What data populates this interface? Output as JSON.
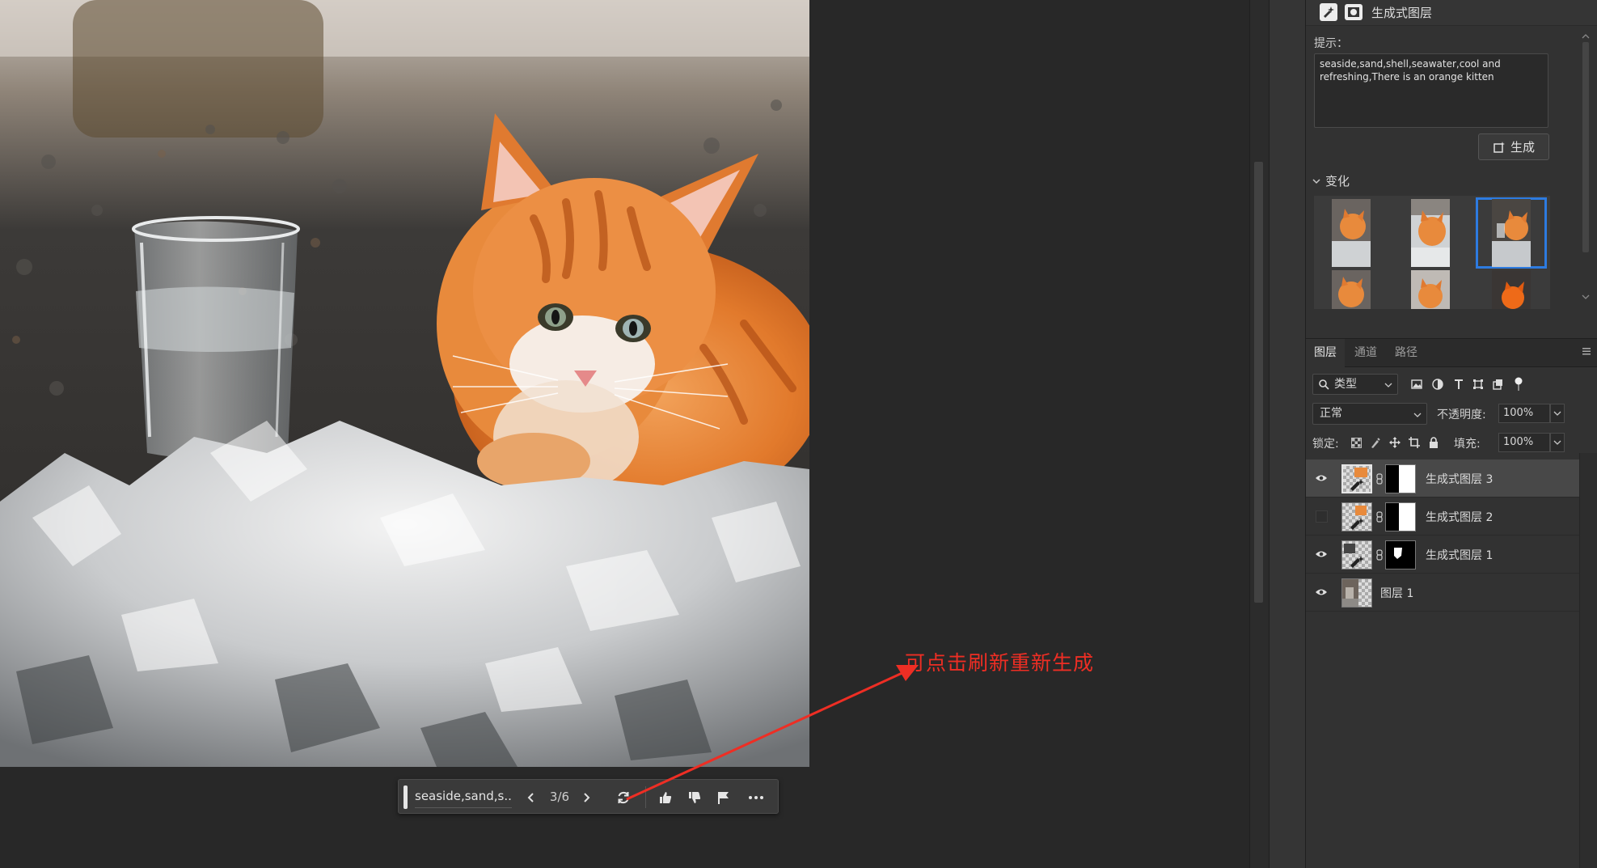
{
  "document": {
    "taskbar": {
      "prompt_text": "seaside,sand,s...",
      "counter": "3/6"
    },
    "annotation": "可点击刷新重新生成"
  },
  "generative_panel": {
    "title": "生成式图层",
    "prompt_label": "提示：",
    "prompt_value": "seaside,sand,shell,seawater,cool and refreshing,There is an orange kitten",
    "generate_label": "生成",
    "variations_label": "变化",
    "variations_count": 6,
    "selected_variation": 3
  },
  "layers_panel": {
    "tabs": [
      "图层",
      "通道",
      "路径"
    ],
    "active_tab": "图层",
    "filter_label": "类型",
    "blend_mode": "正常",
    "opacity_label": "不透明度:",
    "opacity_value": "100%",
    "lock_label": "锁定:",
    "fill_label": "填充:",
    "fill_value": "100%",
    "layers": [
      {
        "name": "生成式图层 3",
        "visible": true,
        "selected": true
      },
      {
        "name": "生成式图层 2",
        "visible": false,
        "selected": false
      },
      {
        "name": "生成式图层 1",
        "visible": true,
        "selected": false
      },
      {
        "name": "图层 1",
        "visible": true,
        "selected": false
      }
    ]
  },
  "colors": {
    "annotation": "#ee2e24",
    "selection": "#2d7be0",
    "background": "#282828"
  }
}
